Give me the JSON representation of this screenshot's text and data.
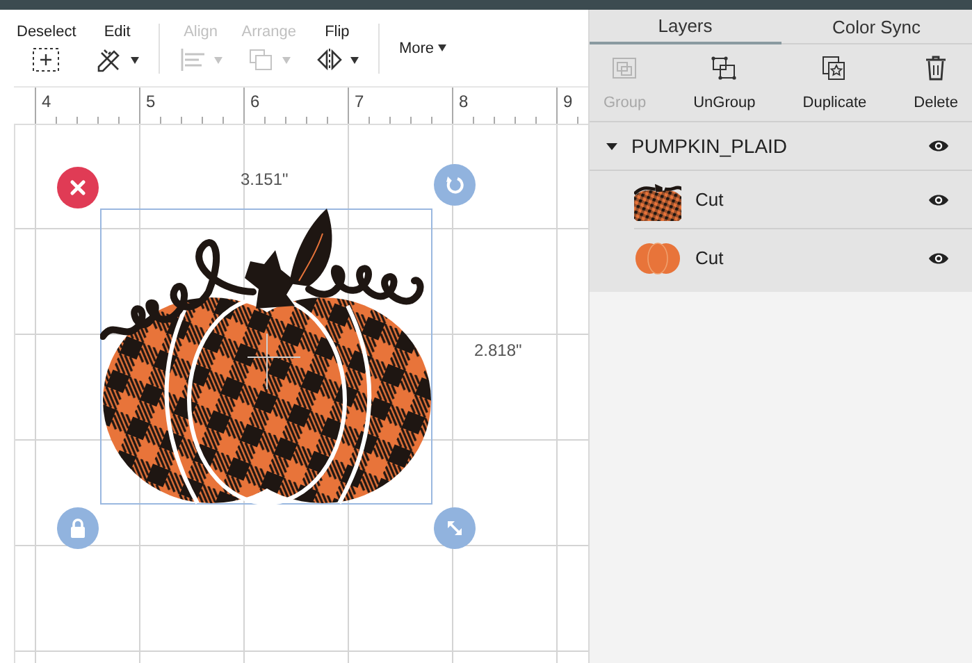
{
  "toolbar": {
    "items": [
      {
        "kind": "deselect",
        "label": "Deselect",
        "disabled": false,
        "caret": false
      },
      {
        "kind": "edit",
        "label": "Edit",
        "disabled": false,
        "caret": true
      },
      {
        "kind": "divider"
      },
      {
        "kind": "align",
        "label": "Align",
        "disabled": true,
        "caret": true
      },
      {
        "kind": "arrange",
        "label": "Arrange",
        "disabled": true,
        "caret": true
      },
      {
        "kind": "flip",
        "label": "Flip",
        "disabled": false,
        "caret": true
      },
      {
        "kind": "divider"
      },
      {
        "kind": "more",
        "label": "More",
        "disabled": false,
        "caret": true
      }
    ]
  },
  "ruler": {
    "labels": [
      "4",
      "5",
      "6",
      "7",
      "8",
      "9"
    ]
  },
  "selection": {
    "width": "3.151\"",
    "height": "2.818\""
  },
  "layers_panel": {
    "tabs": [
      {
        "label": "Layers",
        "selected": true
      },
      {
        "label": "Color Sync",
        "selected": false
      }
    ],
    "actions": [
      {
        "kind": "group",
        "label": "Group",
        "disabled": true
      },
      {
        "kind": "ungroup",
        "label": "UnGroup",
        "disabled": false
      },
      {
        "kind": "duplicate",
        "label": "Duplicate",
        "disabled": false
      },
      {
        "kind": "delete",
        "label": "Delete",
        "disabled": false
      }
    ],
    "groups": [
      {
        "name": "PUMPKIN_PLAID",
        "expanded": true,
        "visible": true,
        "children": [
          {
            "kind": "plaid",
            "label": "Cut",
            "visible": true
          },
          {
            "kind": "solid",
            "label": "Cut",
            "visible": true
          }
        ]
      }
    ]
  }
}
